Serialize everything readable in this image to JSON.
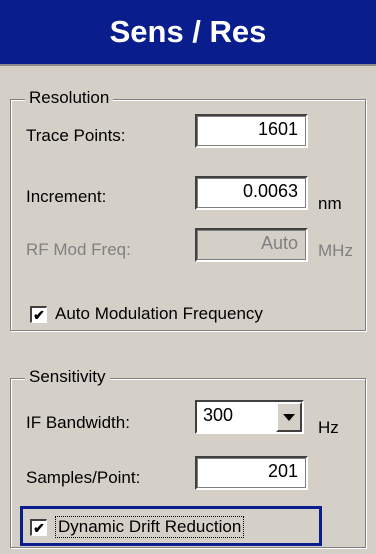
{
  "header": {
    "title": "Sens / Res"
  },
  "resolution": {
    "title": "Resolution",
    "trace_points": {
      "label": "Trace Points:",
      "value": "1601"
    },
    "increment": {
      "label": "Increment:",
      "value": "0.0063",
      "unit": "nm"
    },
    "rf_mod_freq": {
      "label": "RF Mod Freq:",
      "value": "Auto",
      "unit": "MHz"
    },
    "auto_mod": {
      "label": "Auto Modulation Frequency",
      "checked": true
    }
  },
  "sensitivity": {
    "title": "Sensitivity",
    "if_bandwidth": {
      "label": "IF Bandwidth:",
      "value": "300",
      "unit": "Hz"
    },
    "samples_point": {
      "label": "Samples/Point:",
      "value": "201"
    },
    "drift": {
      "label": "Dynamic Drift Reduction",
      "checked": true
    }
  },
  "icons": {
    "check": "✔",
    "dropdown": "triangle-down"
  }
}
